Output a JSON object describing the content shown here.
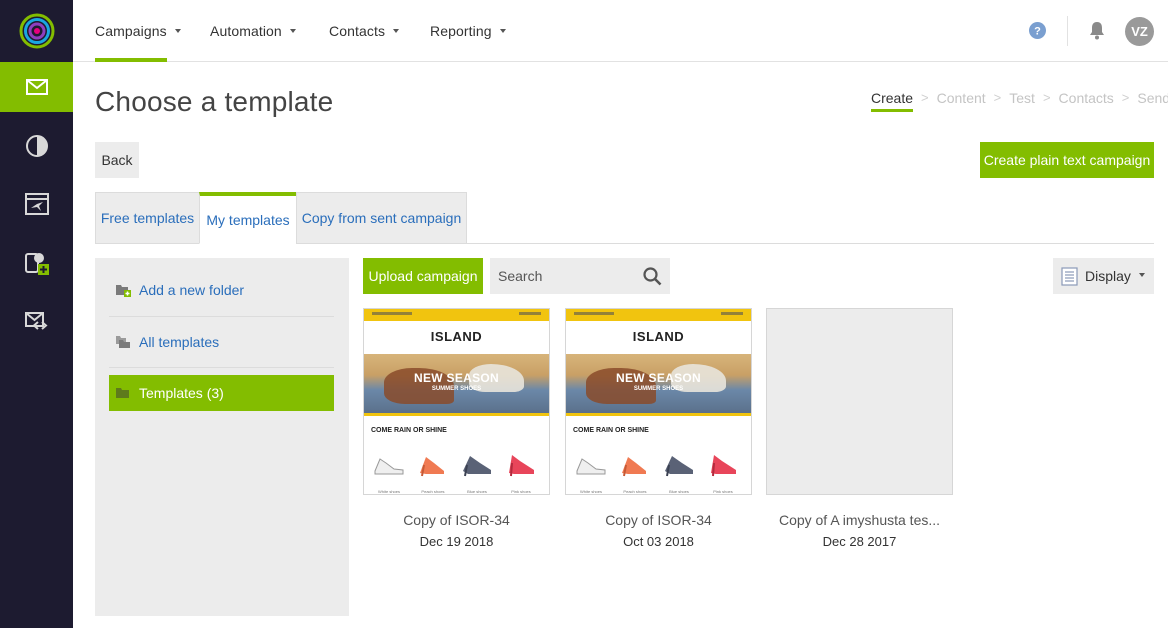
{
  "nav": {
    "menu": [
      {
        "label": "Campaigns"
      },
      {
        "label": "Automation"
      },
      {
        "label": "Contacts"
      },
      {
        "label": "Reporting"
      }
    ],
    "avatar_initials": "VZ"
  },
  "rail": {
    "items": [
      {
        "icon": "envelope-icon",
        "active": true
      },
      {
        "icon": "pie-chart-icon",
        "active": false
      },
      {
        "icon": "automation-icon",
        "active": false
      },
      {
        "icon": "contacts-add-icon",
        "active": false
      },
      {
        "icon": "email-code-icon",
        "active": false
      }
    ]
  },
  "page": {
    "title": "Choose a template",
    "steps": [
      {
        "label": "Create",
        "active": true
      },
      {
        "label": "Content",
        "active": false
      },
      {
        "label": "Test",
        "active": false
      },
      {
        "label": "Contacts",
        "active": false
      },
      {
        "label": "Send",
        "active": false
      }
    ],
    "back_label": "Back",
    "plain_text_label": "Create plain text campaign"
  },
  "tabs": [
    {
      "label": "Free templates",
      "active": false
    },
    {
      "label": "My templates",
      "active": true
    },
    {
      "label": "Copy from sent campaign",
      "active": false
    }
  ],
  "folders": {
    "add_label": "Add a new folder",
    "all_label": "All templates",
    "current_label": "Templates (3)"
  },
  "toolbar": {
    "upload_label": "Upload campaign",
    "search_placeholder": "Search",
    "display_label": "Display"
  },
  "templates": [
    {
      "name": "Copy of ISOR-34",
      "date": "Dec 19 2018",
      "has_preview": true
    },
    {
      "name": "Copy of ISOR-34",
      "date": "Oct 03 2018",
      "has_preview": true
    },
    {
      "name": "Copy of A imyshusta tes...",
      "date": "Dec 28 2017",
      "has_preview": false
    }
  ],
  "preview": {
    "brand": "ISLAND",
    "headline": "NEW SEASON",
    "subhead": "SUMMER SHOES",
    "section": "COME RAIN OR SHINE",
    "shoes": [
      "White shoes",
      "Peach shoes",
      "Blue shoes",
      "Pink shoes"
    ]
  },
  "colors": {
    "accent": "#83bd00",
    "rail_bg": "#1d1b30",
    "link": "#2a6ebb",
    "panel_bg": "#ececec"
  }
}
